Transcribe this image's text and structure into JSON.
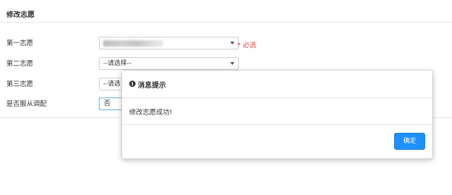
{
  "page": {
    "title": "修改志愿"
  },
  "form": {
    "rows": [
      {
        "label": "第一志愿",
        "value": "",
        "note": "* 必选"
      },
      {
        "label": "第二志愿",
        "value": "--请选择--"
      },
      {
        "label": "第三志愿",
        "value": "--请选"
      },
      {
        "label": "是否服从调配",
        "value": "否"
      }
    ]
  },
  "modal": {
    "title": "消息提示",
    "message": "修改志愿成功!",
    "ok_label": "确定",
    "icon": "info-circle-icon"
  },
  "colors": {
    "required": "#e74c3c",
    "primary_button": "#1e90ff",
    "focus_border": "#66afe9"
  }
}
